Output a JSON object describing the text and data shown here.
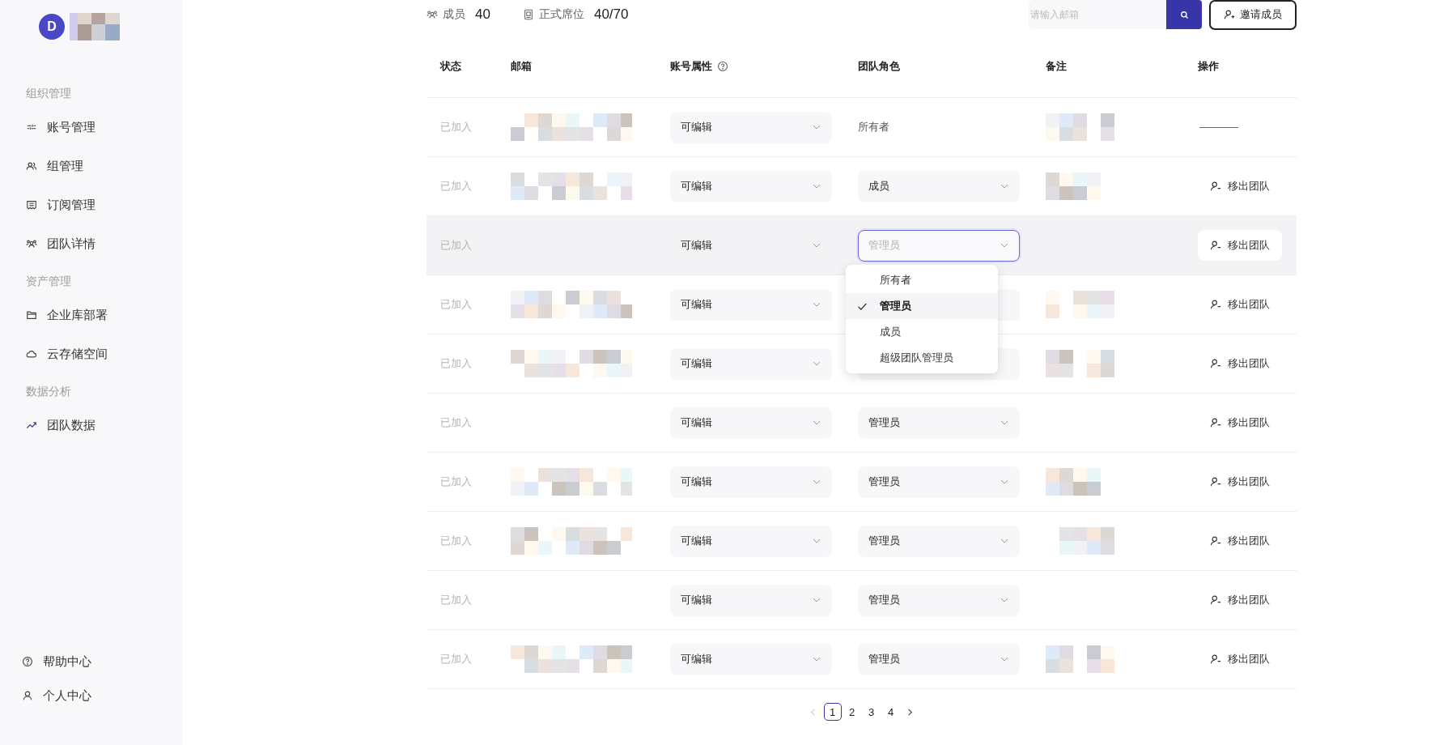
{
  "sidebar": {
    "avatar_letter": "D",
    "name_redacted": true,
    "sections": [
      {
        "title": "组织管理",
        "items": [
          {
            "label": "账号管理"
          },
          {
            "label": "组管理"
          },
          {
            "label": "订阅管理"
          },
          {
            "label": "团队详情"
          }
        ]
      },
      {
        "title": "资产管理",
        "items": [
          {
            "label": "企业库部署"
          },
          {
            "label": "云存储空间"
          }
        ]
      },
      {
        "title": "数据分析",
        "items": [
          {
            "label": "团队数据"
          }
        ]
      }
    ],
    "footer": [
      {
        "label": "帮助中心"
      },
      {
        "label": "个人中心"
      }
    ]
  },
  "summary": {
    "members_label": "成员",
    "members_count": "40",
    "seats_label": "正式席位",
    "seats_count": "40/70"
  },
  "search": {
    "placeholder": "请输入邮箱"
  },
  "invite_button": "邀请成员",
  "table": {
    "columns": [
      "状态",
      "邮箱",
      "账号属性",
      "团队角色",
      "备注",
      "操作"
    ],
    "rows": [
      {
        "status": "已加入",
        "email_redacted": true,
        "account_type": "可编辑",
        "role": {
          "kind": "text",
          "value": "所有者"
        },
        "note_redacted": true,
        "action": {
          "kind": "dash"
        },
        "highlighted": false
      },
      {
        "status": "已加入",
        "email_redacted": true,
        "account_type": "可编辑",
        "role": {
          "kind": "select",
          "value": "成员",
          "focused": false
        },
        "note_redacted": true,
        "action": {
          "kind": "button",
          "label": "移出团队"
        },
        "highlighted": false
      },
      {
        "status": "已加入",
        "email_redacted": false,
        "account_type": "可编辑",
        "role": {
          "kind": "select",
          "placeholder": "管理员",
          "focused": true,
          "menu": {
            "options": [
              {
                "label": "所有者",
                "selected": false
              },
              {
                "label": "管理员",
                "selected": true
              },
              {
                "label": "成员",
                "selected": false
              },
              {
                "label": "超级团队管理员",
                "selected": false
              }
            ]
          }
        },
        "note_redacted": false,
        "action": {
          "kind": "button",
          "label": "移出团队"
        },
        "highlighted": true
      },
      {
        "status": "已加入",
        "email_redacted": true,
        "account_type": "可编辑",
        "role": {
          "kind": "select",
          "focused": false
        },
        "note_redacted": true,
        "action": {
          "kind": "button",
          "label": "移出团队"
        },
        "highlighted": false
      },
      {
        "status": "已加入",
        "email_redacted": true,
        "account_type": "可编辑",
        "role": {
          "kind": "select",
          "focused": false
        },
        "note_redacted": true,
        "action": {
          "kind": "button",
          "label": "移出团队"
        },
        "highlighted": false
      },
      {
        "status": "已加入",
        "email_redacted": false,
        "account_type": "可编辑",
        "role": {
          "kind": "select",
          "value": "管理员",
          "focused": false
        },
        "note_redacted": false,
        "action": {
          "kind": "button",
          "label": "移出团队"
        },
        "highlighted": false
      },
      {
        "status": "已加入",
        "email_redacted": true,
        "account_type": "可编辑",
        "role": {
          "kind": "select",
          "value": "管理员",
          "focused": false
        },
        "note_redacted": true,
        "action": {
          "kind": "button",
          "label": "移出团队"
        },
        "highlighted": false
      },
      {
        "status": "已加入",
        "email_redacted": true,
        "account_type": "可编辑",
        "role": {
          "kind": "select",
          "value": "管理员",
          "focused": false
        },
        "note_redacted": true,
        "action": {
          "kind": "button",
          "label": "移出团队"
        },
        "highlighted": false
      },
      {
        "status": "已加入",
        "email_redacted": false,
        "account_type": "可编辑",
        "role": {
          "kind": "select",
          "value": "管理员",
          "focused": false
        },
        "note_redacted": false,
        "action": {
          "kind": "button",
          "label": "移出团队"
        },
        "highlighted": false
      },
      {
        "status": "已加入",
        "email_redacted": true,
        "account_type": "可编辑",
        "role": {
          "kind": "select",
          "value": "管理员",
          "focused": false
        },
        "note_redacted": true,
        "action": {
          "kind": "button",
          "label": "移出团队"
        },
        "highlighted": false
      }
    ]
  },
  "pagination": {
    "pages": [
      {
        "label": "1",
        "selected": true
      },
      {
        "label": "2",
        "selected": false
      },
      {
        "label": "3",
        "selected": false
      },
      {
        "label": "4",
        "selected": false
      }
    ],
    "prev_disabled": true,
    "next_disabled": false
  }
}
